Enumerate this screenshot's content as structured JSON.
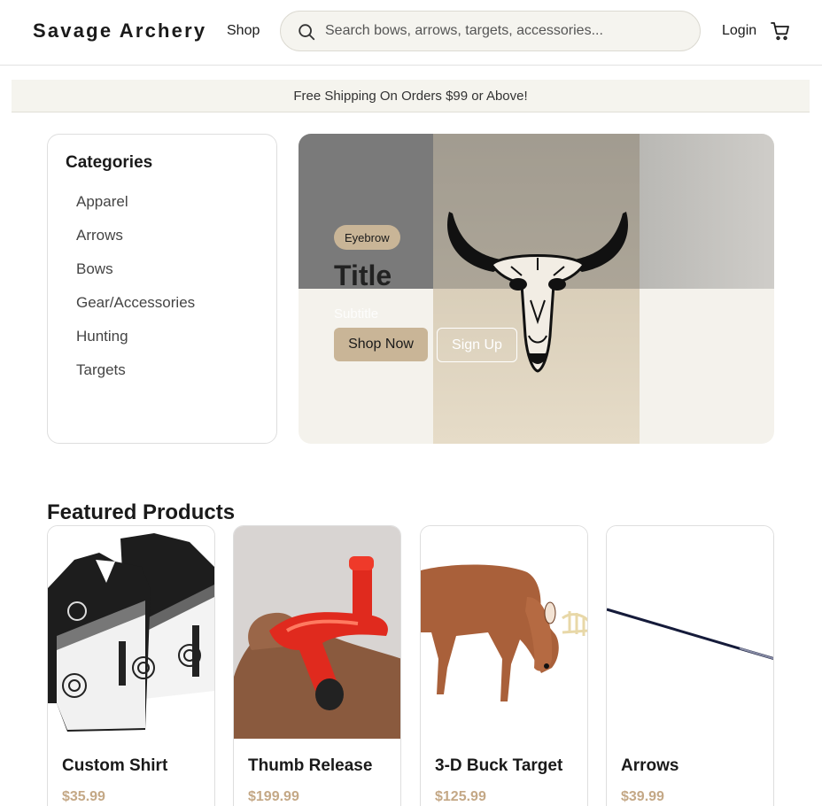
{
  "header": {
    "logo": "Savage Archery",
    "nav_shop": "Shop",
    "search_placeholder": "Search bows, arrows, targets, accessories...",
    "login": "Login"
  },
  "banner": {
    "text": "Free Shipping On Orders $99 or Above!"
  },
  "categories": {
    "title": "Categories",
    "items": [
      "Apparel",
      "Arrows",
      "Bows",
      "Gear/Accessories",
      "Hunting",
      "Targets"
    ]
  },
  "hero": {
    "eyebrow": "Eyebrow",
    "title": "Title",
    "subtitle": "Subtitle",
    "primary_button": "Shop Now",
    "secondary_button": "Sign Up"
  },
  "featured": {
    "title": "Featured Products",
    "products": [
      {
        "name": "Custom Shirt",
        "price": "$35.99"
      },
      {
        "name": "Thumb Release",
        "price": "$199.99"
      },
      {
        "name": "3-D Buck Target",
        "price": "$125.99"
      },
      {
        "name": "Arrows",
        "price": "$39.99"
      }
    ]
  },
  "colors": {
    "accent": "#c9b597",
    "price": "#c4a886",
    "banner_bg": "#f5f4ee"
  }
}
